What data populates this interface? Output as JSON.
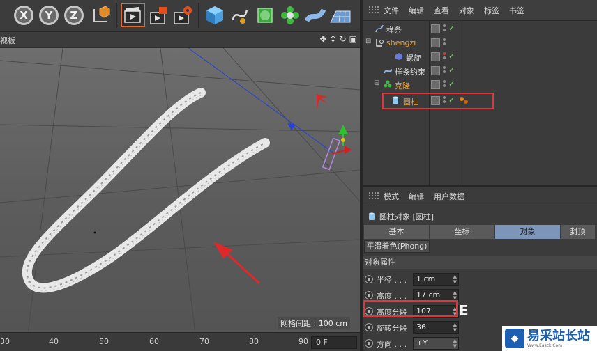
{
  "viewport": {
    "label": "视板",
    "grid_spacing": "网格间距 : 100 cm",
    "nav_icons": [
      "move-view-icon",
      "zoom-view-icon",
      "rotate-view-icon",
      "maximize-view-icon"
    ]
  },
  "toolbar": {
    "axis_x": "X",
    "axis_y": "Y",
    "axis_z": "Z"
  },
  "timeline": {
    "ticks": [
      "30",
      "40",
      "50",
      "60",
      "70",
      "80",
      "90"
    ],
    "frame": "0 F"
  },
  "object_manager": {
    "menu": [
      "文件",
      "编辑",
      "查看",
      "对象",
      "标签",
      "书签"
    ],
    "items": [
      {
        "name": "样条",
        "color": "#d8d8d8",
        "indent": 0,
        "icon": "spline-icon"
      },
      {
        "name": "shengzi",
        "color": "#e6a23c",
        "indent": 0,
        "icon": "null-object-icon"
      },
      {
        "name": "螺旋",
        "color": "#d8d8d8",
        "indent": 1,
        "icon": "helix-icon"
      },
      {
        "name": "样条约束",
        "color": "#d8d8d8",
        "indent": 1,
        "icon": "spline-wrap-icon"
      },
      {
        "name": "克隆",
        "color": "#e6a23c",
        "indent": 1,
        "icon": "cloner-icon"
      },
      {
        "name": "圆柱",
        "color": "#e6a23c",
        "indent": 2,
        "icon": "cylinder-icon"
      }
    ]
  },
  "attribute_manager": {
    "menu": [
      "模式",
      "编辑",
      "用户数据"
    ],
    "title": "圆柱对象 [圆柱]",
    "tabs": [
      "基本",
      "坐标",
      "对象",
      "封顶"
    ],
    "active_tab": "对象",
    "phong_button": "平滑着色(Phong)",
    "section": "对象属性",
    "props": [
      {
        "label": "半径 . . .",
        "value": "1 cm"
      },
      {
        "label": "高度 . . .",
        "value": "17 cm"
      },
      {
        "label": "高度分段",
        "value": "107"
      },
      {
        "label": "旋转分段",
        "value": "36"
      },
      {
        "label": "方向 . . .",
        "value": "+Y"
      }
    ],
    "annotation": "E"
  },
  "watermark": {
    "text": "易采站长站",
    "url": "Www.Easck.Com"
  }
}
